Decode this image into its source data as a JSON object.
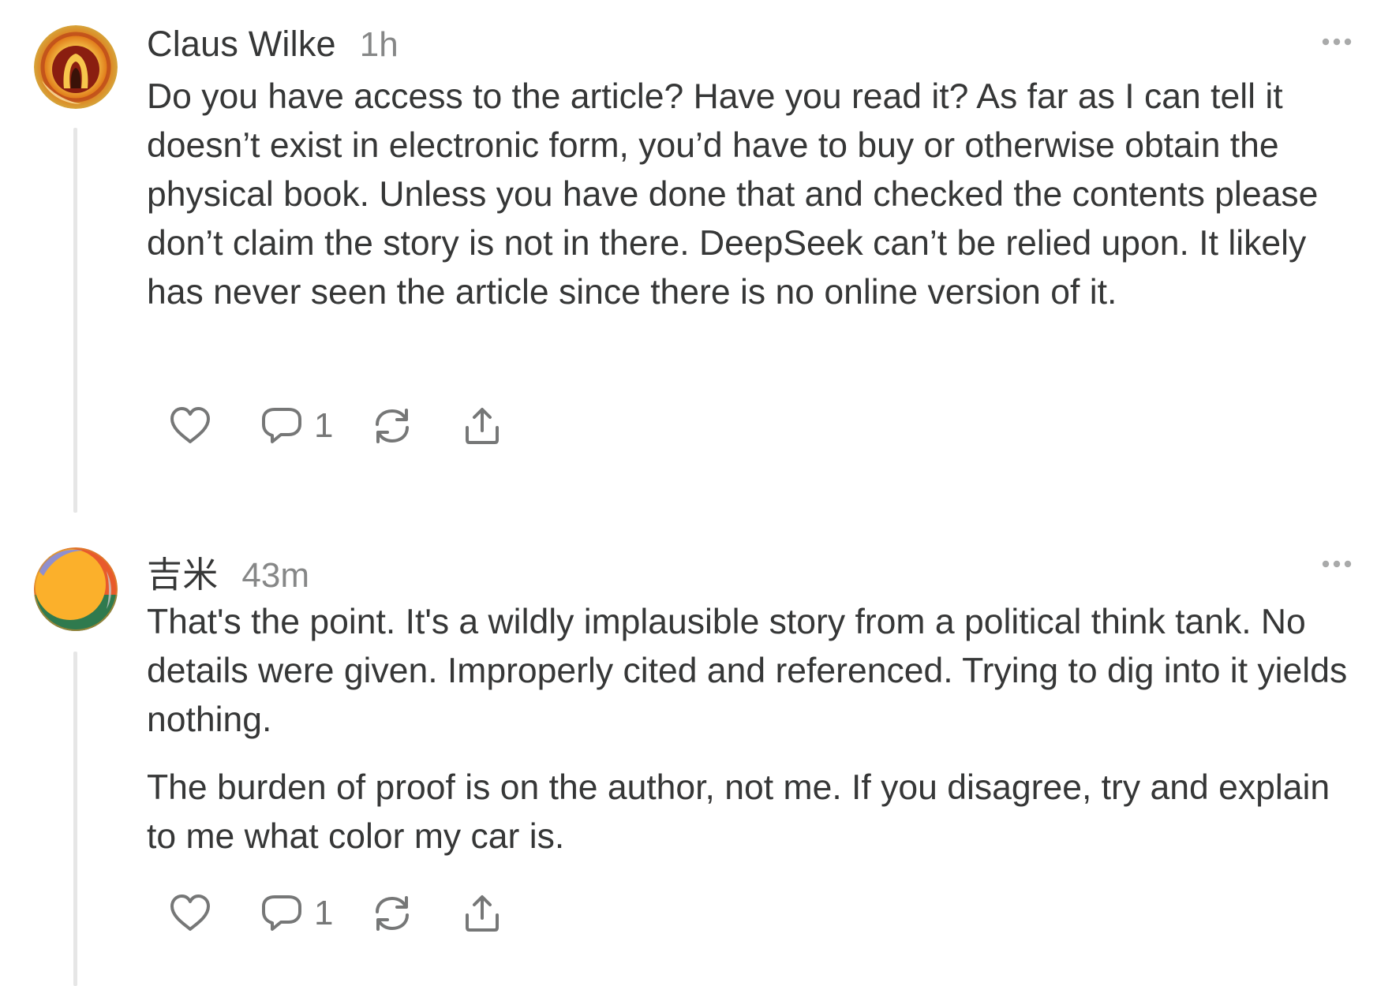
{
  "comments": [
    {
      "author": "Claus Wilke",
      "time": "1h",
      "paragraphs": [
        "Do you have access to the article? Have you read it? As far as I can tell it doesn’t exist in electronic form, you’d have to buy or otherwise obtain the physical book. Unless you have done that and checked the contents please don’t claim the story is not in there. DeepSeek can’t be relied upon. It likely has never seen the article since there is no online version of it."
      ],
      "reply_count": "1",
      "icons": {
        "like": "heart-icon",
        "reply": "speech-bubble-icon",
        "restack": "restack-icon",
        "share": "share-icon",
        "more": "more-dots-icon"
      }
    },
    {
      "author": "吉米",
      "time": "43m",
      "paragraphs": [
        "That's the point. It's a wildly implausible story from a political think tank. No details were given. Improperly cited and referenced. Trying to dig into it yields nothing.",
        "The burden of proof is on the author, not me. If you disagree, try and explain to me what color my car is."
      ],
      "reply_count": "1",
      "icons": {
        "like": "heart-icon",
        "reply": "speech-bubble-icon",
        "restack": "restack-icon",
        "share": "share-icon",
        "more": "more-dots-icon"
      }
    }
  ],
  "colors": {
    "text": "#363737",
    "muted": "#868787",
    "icon": "#767777",
    "thread_line": "#e6e6e6"
  }
}
